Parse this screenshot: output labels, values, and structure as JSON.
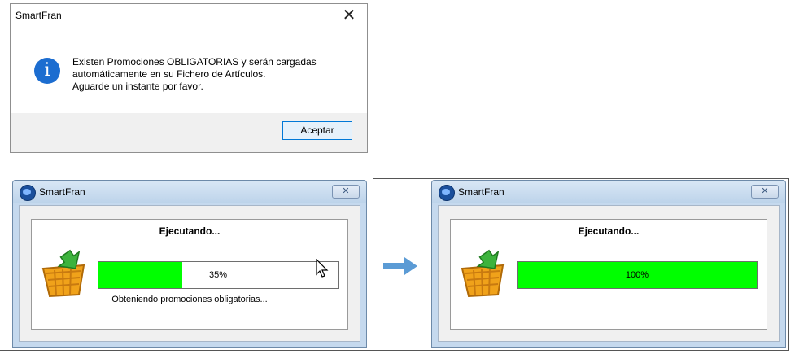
{
  "message_box": {
    "title": "SmartFran",
    "close_glyph": "✕",
    "icon": "info-icon",
    "icon_glyph": "i",
    "message": "Existen Promociones OBLIGATORIAS y serán cargadas\nautomáticamente en su Fichero de Artículos.\nAguarde un instante por favor.",
    "ok_label": "Aceptar"
  },
  "progress_before": {
    "title": "SmartFran",
    "close_glyph": "✕",
    "heading": "Ejecutando...",
    "progress_fraction": 0.35,
    "progress_text": "35%",
    "status_text": "Obteniendo promociones obligatorias..."
  },
  "progress_after": {
    "title": "SmartFran",
    "close_glyph": "✕",
    "heading": "Ejecutando...",
    "progress_fraction": 1.0,
    "progress_text": "100%",
    "status_text": ""
  },
  "colors": {
    "progress_fill": "#00ff00",
    "info_blue": "#1c6dd0",
    "arrow_blue": "#5b9bd5"
  },
  "icons": [
    "info-icon",
    "close-icon",
    "app-globe-icon",
    "shopping-basket-icon",
    "mouse-cursor-icon",
    "right-arrow-icon"
  ]
}
